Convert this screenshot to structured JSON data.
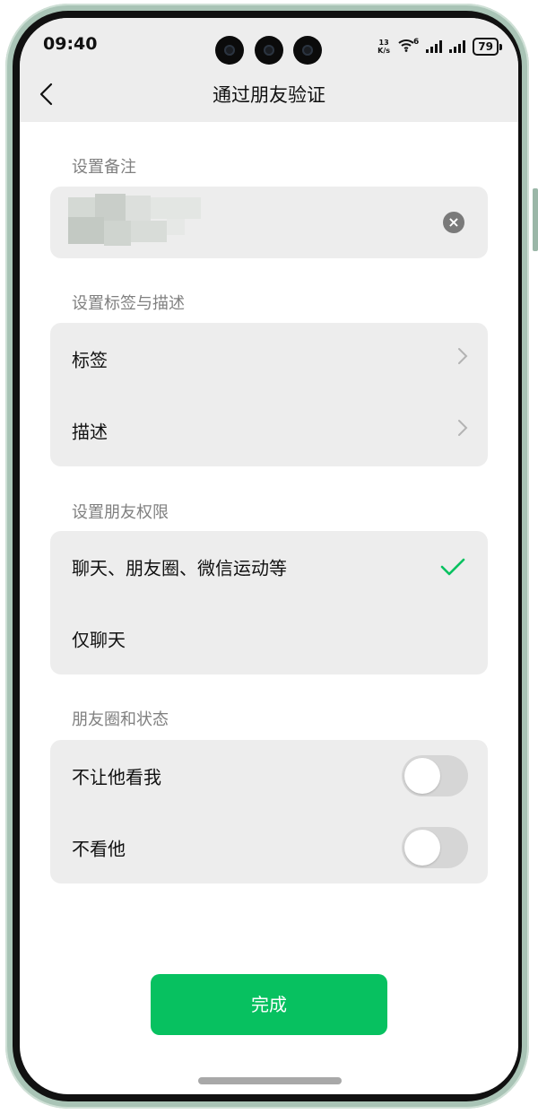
{
  "status_bar": {
    "time": "09:40",
    "net_speed_value": "13",
    "net_speed_unit": "K/s",
    "wifi_label": "6",
    "battery": "79"
  },
  "nav": {
    "title": "通过朋友验证"
  },
  "remark": {
    "section_label": "设置备注"
  },
  "tags": {
    "section_label": "设置标签与描述",
    "items": [
      {
        "label": "标签"
      },
      {
        "label": "描述"
      }
    ]
  },
  "permissions": {
    "section_label": "设置朋友权限",
    "options": [
      {
        "label": "聊天、朋友圈、微信运动等",
        "selected": true
      },
      {
        "label": "仅聊天",
        "selected": false
      }
    ]
  },
  "moments": {
    "section_label": "朋友圈和状态",
    "items": [
      {
        "label": "不让他看我",
        "enabled": false
      },
      {
        "label": "不看他",
        "enabled": false
      }
    ]
  },
  "done_button": {
    "label": "完成"
  },
  "colors": {
    "accent": "#07c160",
    "card_bg": "#ededed",
    "section_label": "#808080"
  }
}
